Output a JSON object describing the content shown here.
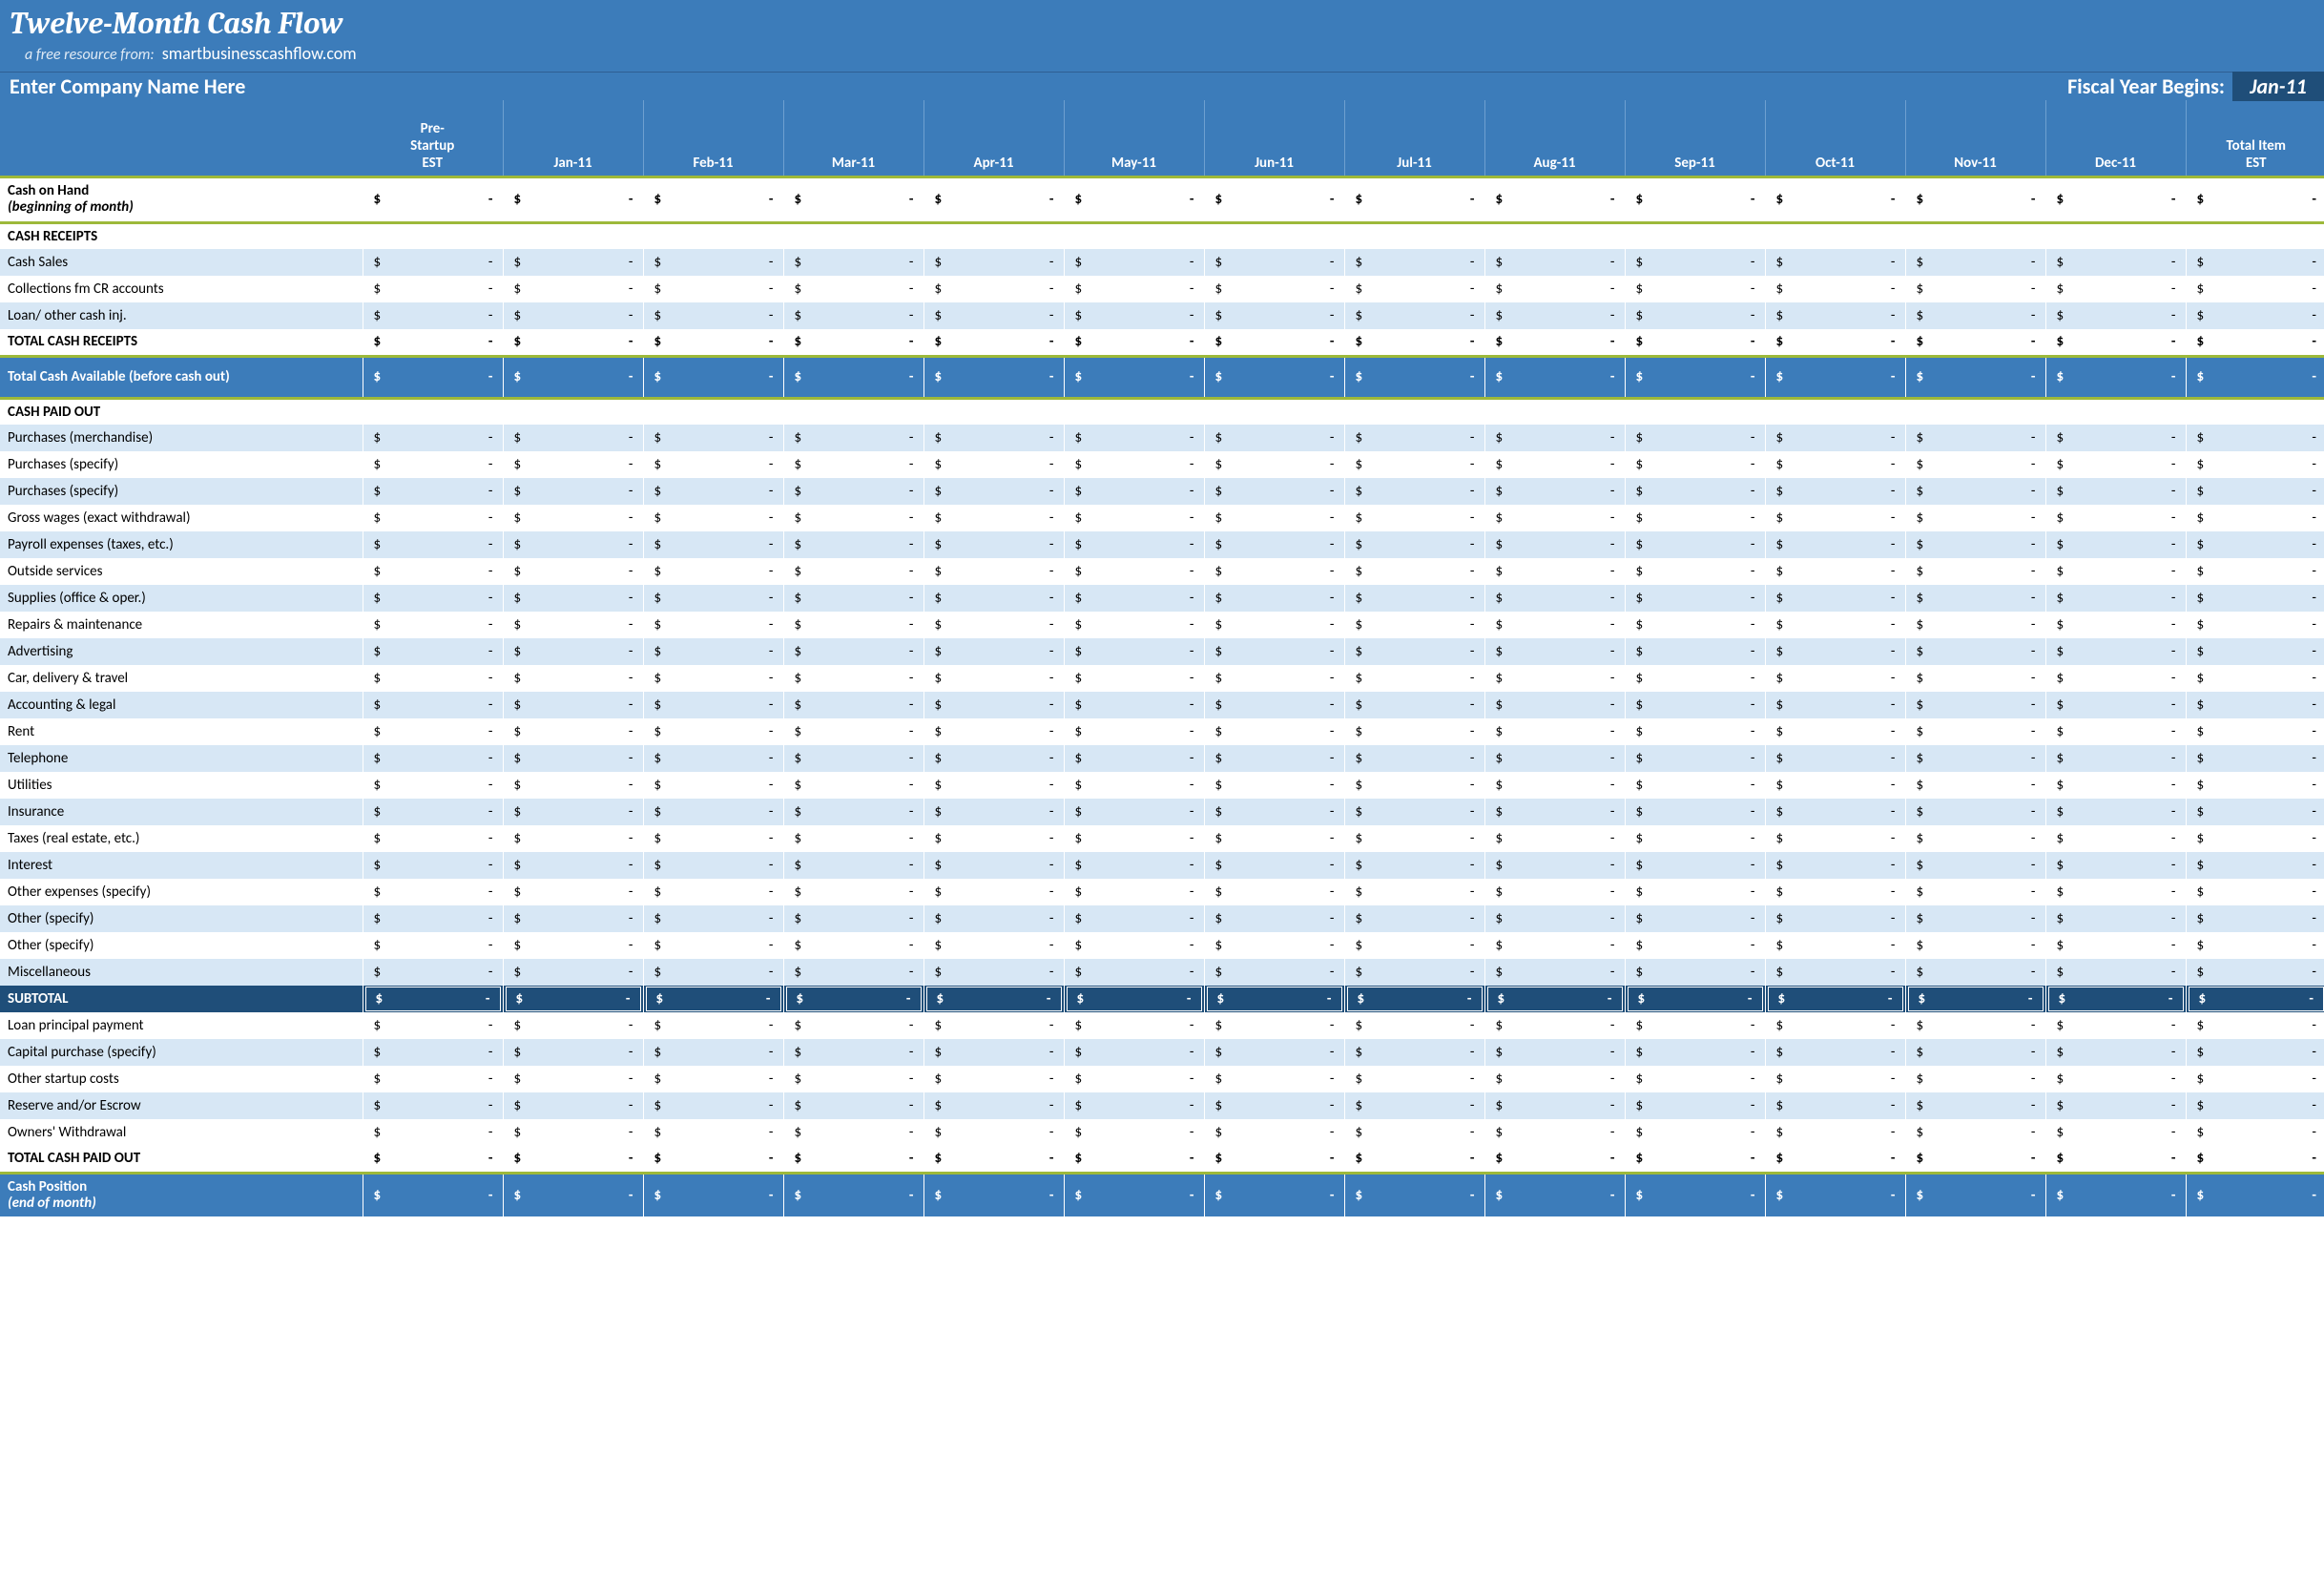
{
  "header": {
    "title": "Twelve-Month Cash Flow",
    "subtitle_lead": "a free resource from:",
    "subtitle_site": "smartbusinesscashflow.com",
    "company_name": "Enter Company Name Here",
    "fiscal_year_label": "Fiscal Year Begins:",
    "fiscal_year_value": "Jan-11"
  },
  "columns": [
    "Pre-Startup EST",
    "Jan-11",
    "Feb-11",
    "Mar-11",
    "Apr-11",
    "May-11",
    "Jun-11",
    "Jul-11",
    "Aug-11",
    "Sep-11",
    "Oct-11",
    "Nov-11",
    "Dec-11",
    "Total Item EST"
  ],
  "cash_on_hand": {
    "label_main": "Cash on Hand",
    "label_sub": "(beginning of month)",
    "values": [
      "-",
      "-",
      "-",
      "-",
      "-",
      "-",
      "-",
      "-",
      "-",
      "-",
      "-",
      "-",
      "-",
      "-"
    ]
  },
  "cash_receipts": {
    "section_label": "CASH RECEIPTS",
    "rows": [
      {
        "label": "Cash Sales",
        "values": [
          "-",
          "-",
          "-",
          "-",
          "-",
          "-",
          "-",
          "-",
          "-",
          "-",
          "-",
          "-",
          "-",
          "-"
        ]
      },
      {
        "label": "Collections fm CR accounts",
        "values": [
          "-",
          "-",
          "-",
          "-",
          "-",
          "-",
          "-",
          "-",
          "-",
          "-",
          "-",
          "-",
          "-",
          "-"
        ]
      },
      {
        "label": "Loan/ other cash inj.",
        "values": [
          "-",
          "-",
          "-",
          "-",
          "-",
          "-",
          "-",
          "-",
          "-",
          "-",
          "-",
          "-",
          "-",
          "-"
        ]
      }
    ],
    "total_label": "TOTAL CASH RECEIPTS",
    "total_values": [
      "-",
      "-",
      "-",
      "-",
      "-",
      "-",
      "-",
      "-",
      "-",
      "-",
      "-",
      "-",
      "-",
      "-"
    ],
    "available_label": "Total Cash Available (before cash out)",
    "available_values": [
      "-",
      "-",
      "-",
      "-",
      "-",
      "-",
      "-",
      "-",
      "-",
      "-",
      "-",
      "-",
      "-",
      "-"
    ]
  },
  "cash_paid_out": {
    "section_label": "CASH PAID OUT",
    "rows": [
      {
        "label": "Purchases (merchandise)",
        "values": [
          "-",
          "-",
          "-",
          "-",
          "-",
          "-",
          "-",
          "-",
          "-",
          "-",
          "-",
          "-",
          "-",
          "-"
        ]
      },
      {
        "label": "Purchases (specify)",
        "values": [
          "-",
          "-",
          "-",
          "-",
          "-",
          "-",
          "-",
          "-",
          "-",
          "-",
          "-",
          "-",
          "-",
          "-"
        ]
      },
      {
        "label": "Purchases (specify)",
        "values": [
          "-",
          "-",
          "-",
          "-",
          "-",
          "-",
          "-",
          "-",
          "-",
          "-",
          "-",
          "-",
          "-",
          "-"
        ]
      },
      {
        "label": "Gross wages (exact withdrawal)",
        "values": [
          "-",
          "-",
          "-",
          "-",
          "-",
          "-",
          "-",
          "-",
          "-",
          "-",
          "-",
          "-",
          "-",
          "-"
        ]
      },
      {
        "label": "Payroll expenses (taxes, etc.)",
        "values": [
          "-",
          "-",
          "-",
          "-",
          "-",
          "-",
          "-",
          "-",
          "-",
          "-",
          "-",
          "-",
          "-",
          "-"
        ]
      },
      {
        "label": "Outside services",
        "values": [
          "-",
          "-",
          "-",
          "-",
          "-",
          "-",
          "-",
          "-",
          "-",
          "-",
          "-",
          "-",
          "-",
          "-"
        ]
      },
      {
        "label": "Supplies (office & oper.)",
        "values": [
          "-",
          "-",
          "-",
          "-",
          "-",
          "-",
          "-",
          "-",
          "-",
          "-",
          "-",
          "-",
          "-",
          "-"
        ]
      },
      {
        "label": "Repairs & maintenance",
        "values": [
          "-",
          "-",
          "-",
          "-",
          "-",
          "-",
          "-",
          "-",
          "-",
          "-",
          "-",
          "-",
          "-",
          "-"
        ]
      },
      {
        "label": "Advertising",
        "values": [
          "-",
          "-",
          "-",
          "-",
          "-",
          "-",
          "-",
          "-",
          "-",
          "-",
          "-",
          "-",
          "-",
          "-"
        ]
      },
      {
        "label": "Car, delivery & travel",
        "values": [
          "-",
          "-",
          "-",
          "-",
          "-",
          "-",
          "-",
          "-",
          "-",
          "-",
          "-",
          "-",
          "-",
          "-"
        ]
      },
      {
        "label": "Accounting & legal",
        "values": [
          "-",
          "-",
          "-",
          "-",
          "-",
          "-",
          "-",
          "-",
          "-",
          "-",
          "-",
          "-",
          "-",
          "-"
        ]
      },
      {
        "label": "Rent",
        "values": [
          "-",
          "-",
          "-",
          "-",
          "-",
          "-",
          "-",
          "-",
          "-",
          "-",
          "-",
          "-",
          "-",
          "-"
        ]
      },
      {
        "label": "Telephone",
        "values": [
          "-",
          "-",
          "-",
          "-",
          "-",
          "-",
          "-",
          "-",
          "-",
          "-",
          "-",
          "-",
          "-",
          "-"
        ]
      },
      {
        "label": "Utilities",
        "values": [
          "-",
          "-",
          "-",
          "-",
          "-",
          "-",
          "-",
          "-",
          "-",
          "-",
          "-",
          "-",
          "-",
          "-"
        ]
      },
      {
        "label": "Insurance",
        "values": [
          "-",
          "-",
          "-",
          "-",
          "-",
          "-",
          "-",
          "-",
          "-",
          "-",
          "-",
          "-",
          "-",
          "-"
        ]
      },
      {
        "label": "Taxes (real estate, etc.)",
        "values": [
          "-",
          "-",
          "-",
          "-",
          "-",
          "-",
          "-",
          "-",
          "-",
          "-",
          "-",
          "-",
          "-",
          "-"
        ]
      },
      {
        "label": "Interest",
        "values": [
          "-",
          "-",
          "-",
          "-",
          "-",
          "-",
          "-",
          "-",
          "-",
          "-",
          "-",
          "-",
          "-",
          "-"
        ]
      },
      {
        "label": "Other expenses (specify)",
        "values": [
          "-",
          "-",
          "-",
          "-",
          "-",
          "-",
          "-",
          "-",
          "-",
          "-",
          "-",
          "-",
          "-",
          "-"
        ]
      },
      {
        "label": "Other (specify)",
        "values": [
          "-",
          "-",
          "-",
          "-",
          "-",
          "-",
          "-",
          "-",
          "-",
          "-",
          "-",
          "-",
          "-",
          "-"
        ]
      },
      {
        "label": "Other (specify)",
        "values": [
          "-",
          "-",
          "-",
          "-",
          "-",
          "-",
          "-",
          "-",
          "-",
          "-",
          "-",
          "-",
          "-",
          "-"
        ]
      },
      {
        "label": "Miscellaneous",
        "values": [
          "-",
          "-",
          "-",
          "-",
          "-",
          "-",
          "-",
          "-",
          "-",
          "-",
          "-",
          "-",
          "-",
          "-"
        ]
      }
    ],
    "subtotal_label": "SUBTOTAL",
    "subtotal_values": [
      "-",
      "-",
      "-",
      "-",
      "-",
      "-",
      "-",
      "-",
      "-",
      "-",
      "-",
      "-",
      "-",
      "-"
    ],
    "extra_rows": [
      {
        "label": "Loan principal payment",
        "values": [
          "-",
          "-",
          "-",
          "-",
          "-",
          "-",
          "-",
          "-",
          "-",
          "-",
          "-",
          "-",
          "-",
          "-"
        ]
      },
      {
        "label": "Capital purchase (specify)",
        "values": [
          "-",
          "-",
          "-",
          "-",
          "-",
          "-",
          "-",
          "-",
          "-",
          "-",
          "-",
          "-",
          "-",
          "-"
        ]
      },
      {
        "label": "Other startup costs",
        "values": [
          "-",
          "-",
          "-",
          "-",
          "-",
          "-",
          "-",
          "-",
          "-",
          "-",
          "-",
          "-",
          "-",
          "-"
        ]
      },
      {
        "label": "Reserve and/or Escrow",
        "values": [
          "-",
          "-",
          "-",
          "-",
          "-",
          "-",
          "-",
          "-",
          "-",
          "-",
          "-",
          "-",
          "-",
          "-"
        ]
      },
      {
        "label": "Owners' Withdrawal",
        "values": [
          "-",
          "-",
          "-",
          "-",
          "-",
          "-",
          "-",
          "-",
          "-",
          "-",
          "-",
          "-",
          "-",
          "-"
        ]
      }
    ],
    "total_label": "TOTAL CASH PAID OUT",
    "total_values": [
      "-",
      "-",
      "-",
      "-",
      "-",
      "-",
      "-",
      "-",
      "-",
      "-",
      "-",
      "-",
      "-",
      "-"
    ]
  },
  "cash_position": {
    "label_main": "Cash Position",
    "label_sub": "(end of month)",
    "values": [
      "-",
      "-",
      "-",
      "-",
      "-",
      "-",
      "-",
      "-",
      "-",
      "-",
      "-",
      "-",
      "-",
      "-"
    ]
  },
  "dollar": "$"
}
